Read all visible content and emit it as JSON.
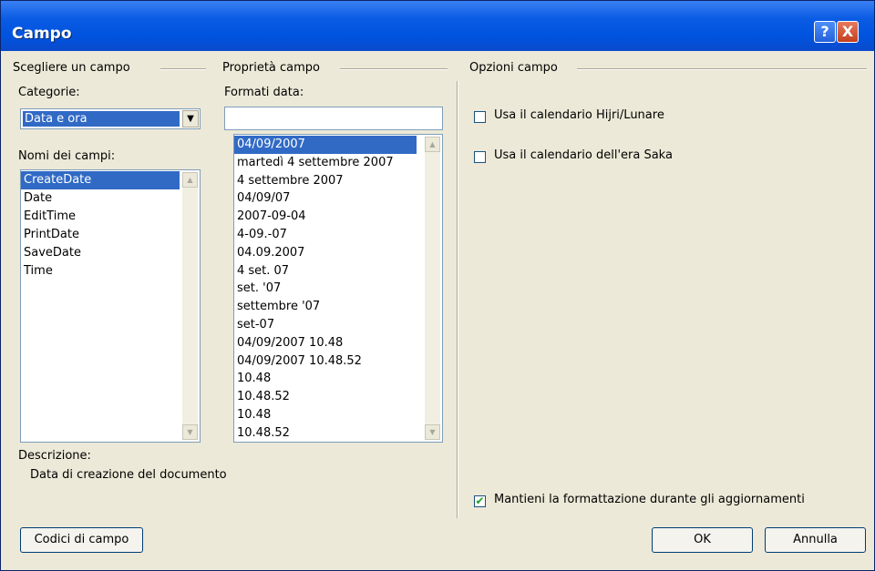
{
  "title": "Campo",
  "titlebar": {
    "help": "?",
    "close": "X"
  },
  "left": {
    "group_label": "Scegliere un campo",
    "categories_label": "Categorie:",
    "categories_value": "Data e ora",
    "fields_label": "Nomi dei campi:",
    "fields": [
      "CreateDate",
      "Date",
      "EditTime",
      "PrintDate",
      "SaveDate",
      "Time"
    ],
    "selected_field": 0
  },
  "middle": {
    "group_label": "Proprietà campo",
    "date_formats_label": "Formati data:",
    "date_format_input": "",
    "formats": [
      "04/09/2007",
      "martedì 4 settembre 2007",
      "4 settembre 2007",
      "04/09/07",
      "2007-09-04",
      "4-09.-07",
      "04.09.2007",
      "4 set. 07",
      "set. '07",
      "settembre '07",
      "set-07",
      "04/09/2007 10.48",
      "04/09/2007 10.48.52",
      "10.48",
      "10.48.52",
      "10.48",
      "10.48.52"
    ],
    "selected_format": 0
  },
  "right": {
    "group_label": "Opzioni campo",
    "option_hijri": "Usa il calendario Hijri/Lunare",
    "option_saka": "Usa il calendario dell'era Saka",
    "keep_format": "Mantieni la formattazione durante gli aggiornamenti",
    "keep_format_checked": true
  },
  "description": {
    "label": "Descrizione:",
    "text": "Data di creazione del documento"
  },
  "buttons": {
    "field_codes": "Codici di campo",
    "ok": "OK",
    "cancel": "Annulla"
  },
  "colors": {
    "selection": "#316ac5",
    "dialog_bg": "#ece9d8",
    "titlebar": "#0053df"
  }
}
